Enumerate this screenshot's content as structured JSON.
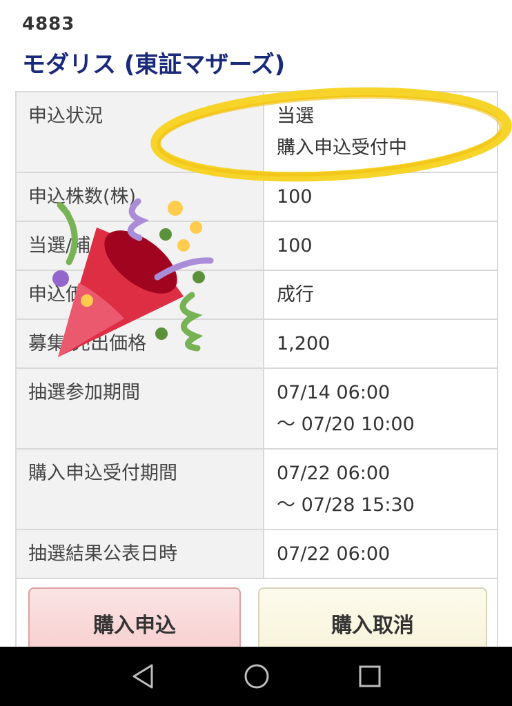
{
  "header": {
    "code": "4883",
    "name": "モダリス (東証マザーズ)"
  },
  "status": {
    "label": "申込状況",
    "line1": "当選",
    "line2": "購入申込受付中"
  },
  "rows": [
    {
      "label": "申込株数(株)",
      "value": "100"
    },
    {
      "label": "当選/補欠株数",
      "value": "100"
    },
    {
      "label": "申込価格",
      "value": "成行"
    },
    {
      "label": "募集/売出価格",
      "value": "1,200"
    }
  ],
  "period_rows": [
    {
      "label": "抽選参加期間",
      "line1": "07/14 06:00",
      "line2": "～ 07/20 10:00"
    },
    {
      "label": "購入申込受付期間",
      "line1": "07/22 06:00",
      "line2": "～ 07/28 15:30"
    }
  ],
  "result_row": {
    "label": "抽選結果公表日時",
    "value": "07/22 06:00"
  },
  "buttons": {
    "apply_label": "購入申込",
    "cancel_label": "購入取消"
  },
  "decorations": {
    "highlight_color": "#f7d21e",
    "sticker": "party-popper-icon"
  },
  "navbar": {
    "back_icon": "back-triangle-icon",
    "home_icon": "home-circle-icon",
    "recent_icon": "recent-apps-square-icon"
  }
}
